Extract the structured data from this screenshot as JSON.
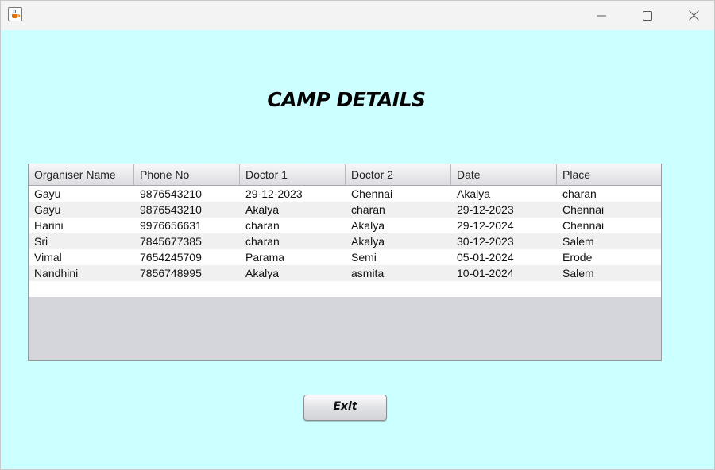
{
  "window": {
    "minimize_icon": "minimize-icon",
    "maximize_icon": "maximize-icon",
    "close_icon": "close-icon",
    "app_icon": "java-cup-icon",
    "background_color": "#ccffff"
  },
  "heading": "CAMP DETAILS",
  "table": {
    "columns": [
      "Organiser Name",
      "Phone No",
      "Doctor 1",
      "Doctor 2",
      "Date",
      "Place"
    ],
    "rows": [
      [
        "Gayu",
        "9876543210",
        "29-12-2023",
        "Chennai",
        "Akalya",
        "charan"
      ],
      [
        "Gayu",
        "9876543210",
        "Akalya",
        "charan",
        "29-12-2023",
        "Chennai"
      ],
      [
        "Harini",
        "9976656631",
        "charan",
        "Akalya",
        "29-12-2024",
        "Chennai"
      ],
      [
        "Sri",
        "7845677385",
        "charan",
        "Akalya",
        "30-12-2023",
        "Salem"
      ],
      [
        "Vimal",
        "7654245709",
        "Parama",
        "Semi",
        "05-01-2024",
        "Erode"
      ],
      [
        "Nandhini",
        "7856748995",
        "Akalya",
        "asmita",
        "10-01-2024",
        "Salem"
      ]
    ]
  },
  "exit_label": "Exit"
}
